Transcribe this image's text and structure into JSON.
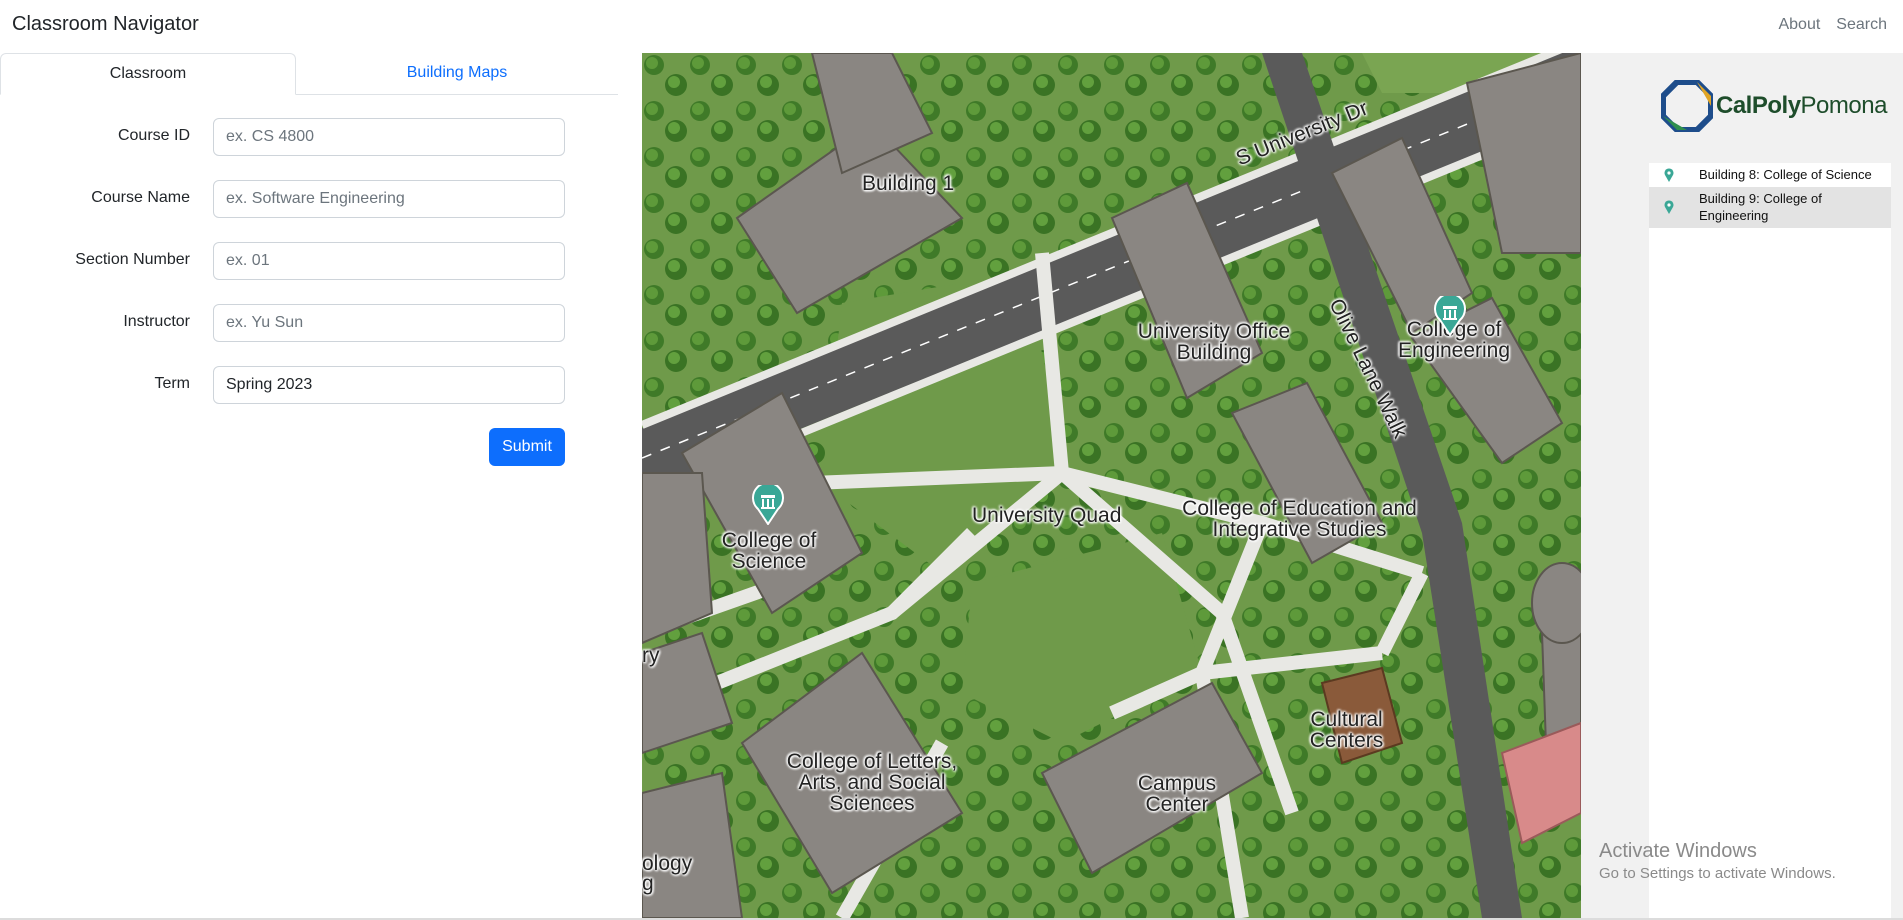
{
  "navbar": {
    "brand": "Classroom Navigator",
    "links": [
      "About",
      "Search"
    ]
  },
  "tabs": {
    "classroom": "Classroom",
    "building_maps": "Building Maps"
  },
  "form": {
    "course_id": {
      "label": "Course ID",
      "placeholder": "ex. CS 4800",
      "value": ""
    },
    "course_name": {
      "label": "Course Name",
      "placeholder": "ex. Software Engineering",
      "value": ""
    },
    "section_number": {
      "label": "Section Number",
      "placeholder": "ex. 01",
      "value": ""
    },
    "instructor": {
      "label": "Instructor",
      "placeholder": "ex. Yu Sun",
      "value": ""
    },
    "term": {
      "label": "Term",
      "placeholder": "",
      "value": "Spring 2023"
    },
    "submit_label": "Submit"
  },
  "map": {
    "labels": {
      "building1": "Building 1",
      "street": "S University Dr",
      "univ_office": "University Office Building",
      "olive": "Olive Lane Walk",
      "engineering": "College of Engineering",
      "science": "College of Science",
      "quad": "University Quad",
      "education": "College of Education and Integrative Studies",
      "letters": "College of Letters, Arts, and Social Sciences",
      "campus_center": "Campus Center",
      "cultural": "Cultural Centers",
      "ry": "ry",
      "ology": "ology",
      "g": "g"
    },
    "pins": [
      "College of Engineering",
      "College of Science"
    ],
    "colors": {
      "grass": "#6f9a4a",
      "path": "#e8e8e4",
      "road": "#5a5a5a",
      "roof": "#8a8682",
      "pin": "#3aa796"
    }
  },
  "sidebar": {
    "logo": {
      "cal": "Cal",
      "poly": "Poly",
      "pomona": "Pomona"
    },
    "items": [
      {
        "label": "Building 8: College of Science",
        "selected": false
      },
      {
        "label": "Building 9: College of Engineering",
        "selected": true
      }
    ]
  },
  "watermark": {
    "line1": "Activate Windows",
    "line2": "Go to Settings to activate Windows."
  }
}
